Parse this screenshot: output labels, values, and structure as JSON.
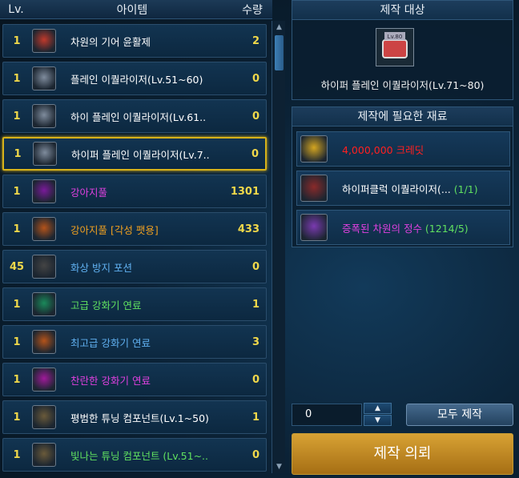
{
  "list_header": {
    "lv": "Lv.",
    "item": "아이템",
    "qty": "수량"
  },
  "items": [
    {
      "lv": "1",
      "name": "차원의 기어 윤활제",
      "qty": "2",
      "color": "#ffffff",
      "icon": "lubricant-icon"
    },
    {
      "lv": "1",
      "name": "플레인 이퀄라이저(Lv.51~60)",
      "qty": "0",
      "color": "#ffffff",
      "icon": "lv60-equalizer-icon"
    },
    {
      "lv": "1",
      "name": "하이 플레인 이퀄라이저(Lv.61..",
      "qty": "0",
      "color": "#ffffff",
      "icon": "lv70-equalizer-icon"
    },
    {
      "lv": "1",
      "name": "하이퍼 플레인 이퀄라이저(Lv.7..",
      "qty": "0",
      "color": "#ffffff",
      "icon": "lv80-equalizer-icon",
      "selected": true
    },
    {
      "lv": "1",
      "name": "강아지풀",
      "qty": "1301",
      "color": "#e040e0",
      "icon": "purple-foxtail-icon"
    },
    {
      "lv": "1",
      "name": "강아지풀 [각성 팻용]",
      "qty": "433",
      "color": "#f0a020",
      "icon": "orange-foxtail-icon"
    },
    {
      "lv": "45",
      "name": "화상 방지 포션",
      "qty": "0",
      "color": "#60b0f0",
      "icon": "potion-icon"
    },
    {
      "lv": "1",
      "name": "고급 강화기 연료",
      "qty": "1",
      "color": "#60e060",
      "icon": "green-fuel-icon"
    },
    {
      "lv": "1",
      "name": "최고급 강화기 연료",
      "qty": "3",
      "color": "#60b0f0",
      "icon": "orange-fuel-icon"
    },
    {
      "lv": "1",
      "name": "찬란한 강화기 연료",
      "qty": "0",
      "color": "#e040e0",
      "icon": "pink-fuel-icon"
    },
    {
      "lv": "1",
      "name": "평범한 튜닝 컴포넌트(Lv.1~50)",
      "qty": "1",
      "color": "#ffffff",
      "icon": "lv50-component-icon"
    },
    {
      "lv": "1",
      "name": "빛나는 튜닝 컴포넌트 (Lv.51~..",
      "qty": "0",
      "color": "#60e060",
      "icon": "lv80-component-icon"
    }
  ],
  "target": {
    "title": "제작 대상",
    "name": "하이퍼 플레인 이퀄라이저(Lv.71~80)",
    "icon": "lv80-equalizer-icon"
  },
  "materials": {
    "title": "제작에 필요한 재료",
    "list": [
      {
        "text": "4,000,000 크레딧",
        "suffix": "",
        "color": "#ff2020",
        "icon": "credit-coin-icon"
      },
      {
        "text": "하이퍼클럭 이퀄라이저(...",
        "suffix": " (1/1)",
        "color": "#ffffff",
        "icon": "lv80-equalizer-icon"
      },
      {
        "text": "증폭된 차원의 정수",
        "suffix": " (1214/5)",
        "color": "#e040e0",
        "icon": "dimension-essence-icon"
      }
    ]
  },
  "quantity": "0",
  "buttons": {
    "all_make": "모두 제작",
    "request": "제작 의뢰"
  }
}
